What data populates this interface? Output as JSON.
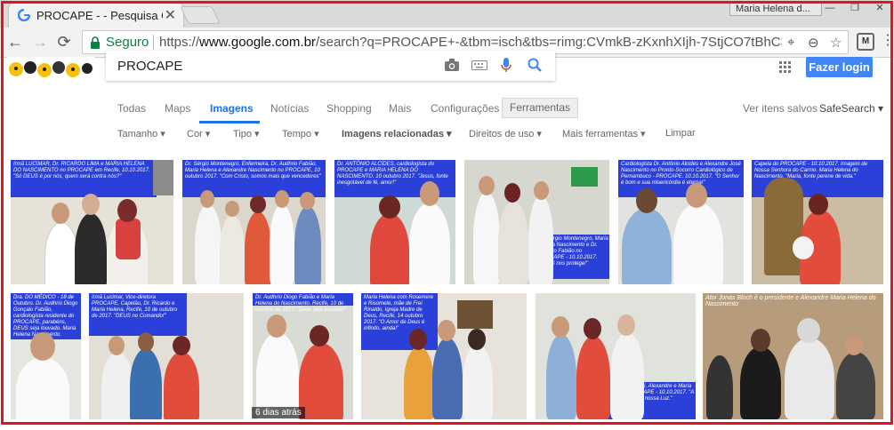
{
  "browser": {
    "tab_title": "PROCAPE - - Pesquisa Go",
    "tab_close": "✕",
    "user_chip": "Maria Helena d...",
    "secure_label": "Seguro",
    "url_prefix": "https://",
    "url_host": "www.google.com.br",
    "url_rest": "/search?q=PROCAPE+-&tbm=isch&tbs=rimg:CVmkB-zKxnhXIjh-7StjCO7tBhC3qIp8...",
    "ext_label": "M"
  },
  "search": {
    "query": "PROCAPE",
    "login_label": "Fazer login"
  },
  "tabs": {
    "todas": "Todas",
    "maps": "Maps",
    "imagens": "Imagens",
    "noticias": "Notícias",
    "shopping": "Shopping",
    "mais": "Mais",
    "config": "Configurações",
    "ferramentas": "Ferramentas",
    "saved": "Ver itens salvos",
    "safesearch": "SafeSearch ▾"
  },
  "filters": {
    "tamanho": "Tamanho ▾",
    "cor": "Cor ▾",
    "tipo": "Tipo ▾",
    "tempo": "Tempo ▾",
    "relacionadas": "Imagens relacionadas ▾",
    "direitos": "Direitos de uso ▾",
    "mais_ferramentas": "Mais ferramentas ▾",
    "limpar": "Limpar"
  },
  "results": {
    "badge": "6 dias atrás",
    "captions": [
      "Irmã LUCIMAR, Dr. RICARDO LIMA e MARIA HELENA DO NASCIMENTO no PROCAPE em Recife, 10.10.2017. \"Só DEUS é por nós, quem será contra nós?\"",
      "Dr. Sérgio Montenegro, Enfermeira, Dr. Audhrio Fabião, Maria Helena e Alexandre Nascimento no PROCAPE, 10 outubro 2017. \"Com Cristo, somos mais que vencedores\"",
      "Dr. ANTÔNIO ALCÍDES, cardiologista do PROCAPE e MARIA HELENA DO NASCIMENTO. 10 outubro 2017. \"Jesus, fonte inesgotável de fé, amor!\"",
      "",
      "Cardiologista Dr. Antônio Alcides e Alexandre José Nascimento no Pronto-Socorro Cardiológico de Pernambuco - PROCAPE. 10.10.2017. \"O Senhor é bom e sua misericórdia é eterna!\"",
      "Capela do PROCAPE - 10.10.2017. Imagem de Nossa Senhora do Carmo. Maria Helena do Nascimento. \"Maria, fonte perene de vida.\"",
      "Dr. Sérgio Montenegro, Maria Helena Nascimento e Dr. Audhrio Fabião no PROCAPE - 10.10.2017. \"DEUS nos protege!\"",
      "Dra. DO MÉDICO - 18 de Outubro. Dr. Audhrio Diogo Gonçalo Fabião, cardiologista residente do PROCAPE, parabéns, DEUS seja louvado. Maria Helena Nascimento.",
      "Irmã Lucimar, Vice-diretora PROCAPE, Capelão, Dr. Ricardo e Maria Helena, Recife, 10 de outubro de 2017. \"DEUS no Comando!\"",
      "Dr. Audhrio Diogo Fabião e Maria Helena do Nascimento. Recife, 10 de outubro de 2017. \"Deus seja louvado!\"",
      "Maria Helena com Rosemere e Risomete, mãe de Frei Rinaldo, Igreja Madre de Deus, Recife, 14 outubro 2017. \"O Amor de Deus é infinito, ainda!\"",
      "Dr. Enio Cantarelli, Alexandre e Maria Helena no PROCAPE - 10.10.2017. \"A Cruz sagrada é a nossa Luz.\"",
      "Ator Jonas Bloch é o presidente e Alexandre Maria Helena do Nascimento"
    ]
  }
}
